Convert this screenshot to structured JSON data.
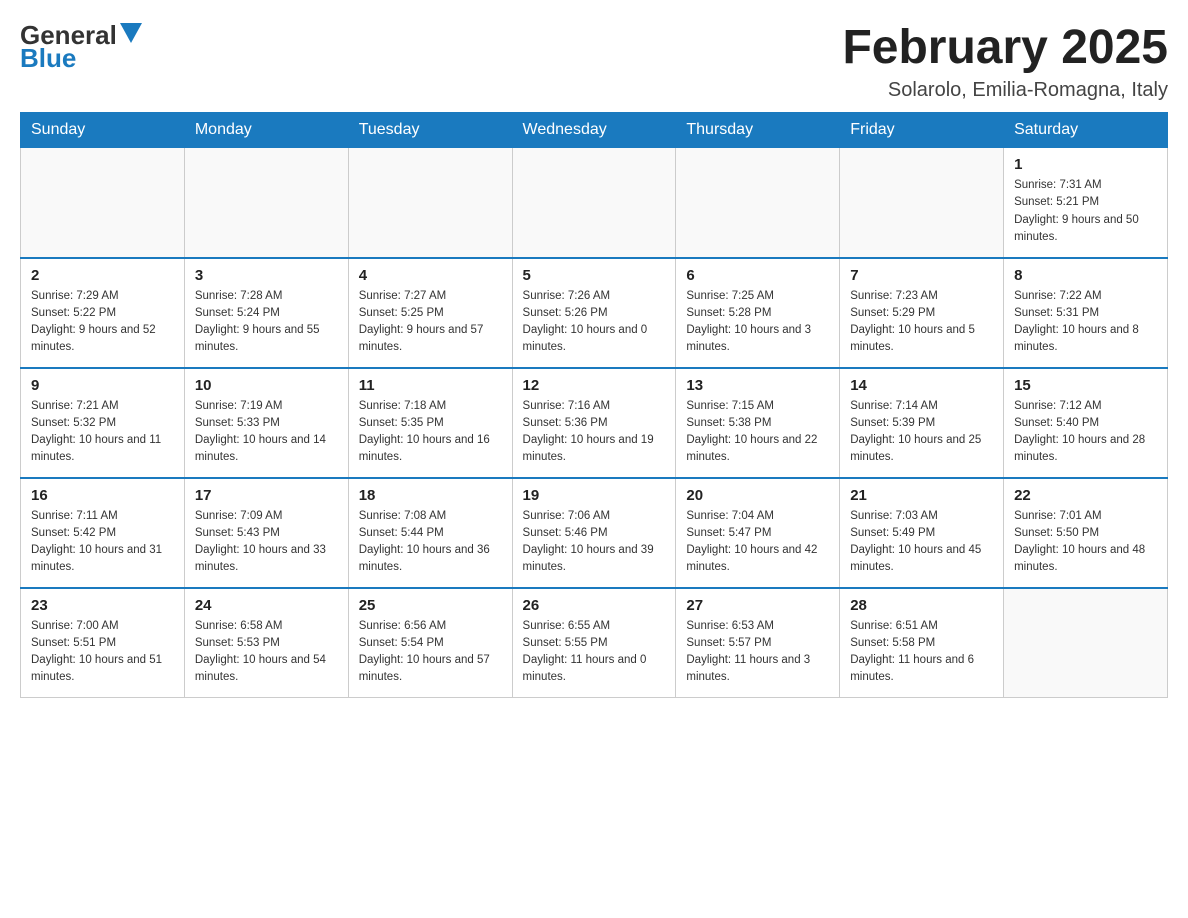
{
  "header": {
    "logo_general": "General",
    "logo_blue": "Blue",
    "month_year": "February 2025",
    "location": "Solarolo, Emilia-Romagna, Italy"
  },
  "days_of_week": [
    "Sunday",
    "Monday",
    "Tuesday",
    "Wednesday",
    "Thursday",
    "Friday",
    "Saturday"
  ],
  "weeks": [
    [
      {
        "day": "",
        "info": ""
      },
      {
        "day": "",
        "info": ""
      },
      {
        "day": "",
        "info": ""
      },
      {
        "day": "",
        "info": ""
      },
      {
        "day": "",
        "info": ""
      },
      {
        "day": "",
        "info": ""
      },
      {
        "day": "1",
        "info": "Sunrise: 7:31 AM\nSunset: 5:21 PM\nDaylight: 9 hours and 50 minutes."
      }
    ],
    [
      {
        "day": "2",
        "info": "Sunrise: 7:29 AM\nSunset: 5:22 PM\nDaylight: 9 hours and 52 minutes."
      },
      {
        "day": "3",
        "info": "Sunrise: 7:28 AM\nSunset: 5:24 PM\nDaylight: 9 hours and 55 minutes."
      },
      {
        "day": "4",
        "info": "Sunrise: 7:27 AM\nSunset: 5:25 PM\nDaylight: 9 hours and 57 minutes."
      },
      {
        "day": "5",
        "info": "Sunrise: 7:26 AM\nSunset: 5:26 PM\nDaylight: 10 hours and 0 minutes."
      },
      {
        "day": "6",
        "info": "Sunrise: 7:25 AM\nSunset: 5:28 PM\nDaylight: 10 hours and 3 minutes."
      },
      {
        "day": "7",
        "info": "Sunrise: 7:23 AM\nSunset: 5:29 PM\nDaylight: 10 hours and 5 minutes."
      },
      {
        "day": "8",
        "info": "Sunrise: 7:22 AM\nSunset: 5:31 PM\nDaylight: 10 hours and 8 minutes."
      }
    ],
    [
      {
        "day": "9",
        "info": "Sunrise: 7:21 AM\nSunset: 5:32 PM\nDaylight: 10 hours and 11 minutes."
      },
      {
        "day": "10",
        "info": "Sunrise: 7:19 AM\nSunset: 5:33 PM\nDaylight: 10 hours and 14 minutes."
      },
      {
        "day": "11",
        "info": "Sunrise: 7:18 AM\nSunset: 5:35 PM\nDaylight: 10 hours and 16 minutes."
      },
      {
        "day": "12",
        "info": "Sunrise: 7:16 AM\nSunset: 5:36 PM\nDaylight: 10 hours and 19 minutes."
      },
      {
        "day": "13",
        "info": "Sunrise: 7:15 AM\nSunset: 5:38 PM\nDaylight: 10 hours and 22 minutes."
      },
      {
        "day": "14",
        "info": "Sunrise: 7:14 AM\nSunset: 5:39 PM\nDaylight: 10 hours and 25 minutes."
      },
      {
        "day": "15",
        "info": "Sunrise: 7:12 AM\nSunset: 5:40 PM\nDaylight: 10 hours and 28 minutes."
      }
    ],
    [
      {
        "day": "16",
        "info": "Sunrise: 7:11 AM\nSunset: 5:42 PM\nDaylight: 10 hours and 31 minutes."
      },
      {
        "day": "17",
        "info": "Sunrise: 7:09 AM\nSunset: 5:43 PM\nDaylight: 10 hours and 33 minutes."
      },
      {
        "day": "18",
        "info": "Sunrise: 7:08 AM\nSunset: 5:44 PM\nDaylight: 10 hours and 36 minutes."
      },
      {
        "day": "19",
        "info": "Sunrise: 7:06 AM\nSunset: 5:46 PM\nDaylight: 10 hours and 39 minutes."
      },
      {
        "day": "20",
        "info": "Sunrise: 7:04 AM\nSunset: 5:47 PM\nDaylight: 10 hours and 42 minutes."
      },
      {
        "day": "21",
        "info": "Sunrise: 7:03 AM\nSunset: 5:49 PM\nDaylight: 10 hours and 45 minutes."
      },
      {
        "day": "22",
        "info": "Sunrise: 7:01 AM\nSunset: 5:50 PM\nDaylight: 10 hours and 48 minutes."
      }
    ],
    [
      {
        "day": "23",
        "info": "Sunrise: 7:00 AM\nSunset: 5:51 PM\nDaylight: 10 hours and 51 minutes."
      },
      {
        "day": "24",
        "info": "Sunrise: 6:58 AM\nSunset: 5:53 PM\nDaylight: 10 hours and 54 minutes."
      },
      {
        "day": "25",
        "info": "Sunrise: 6:56 AM\nSunset: 5:54 PM\nDaylight: 10 hours and 57 minutes."
      },
      {
        "day": "26",
        "info": "Sunrise: 6:55 AM\nSunset: 5:55 PM\nDaylight: 11 hours and 0 minutes."
      },
      {
        "day": "27",
        "info": "Sunrise: 6:53 AM\nSunset: 5:57 PM\nDaylight: 11 hours and 3 minutes."
      },
      {
        "day": "28",
        "info": "Sunrise: 6:51 AM\nSunset: 5:58 PM\nDaylight: 11 hours and 6 minutes."
      },
      {
        "day": "",
        "info": ""
      }
    ]
  ]
}
